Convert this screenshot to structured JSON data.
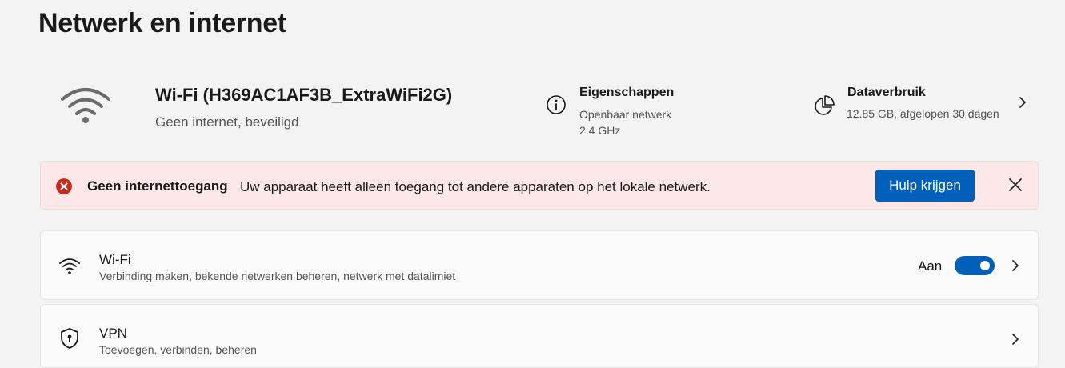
{
  "page": {
    "title": "Netwerk en internet"
  },
  "connection": {
    "name": "Wi-Fi (H369AC1AF3B_ExtraWiFi2G)",
    "status": "Geen internet, beveiligd",
    "icon": "wifi-icon"
  },
  "properties": {
    "title": "Eigenschappen",
    "network_type": "Openbaar netwerk",
    "band": "2.4 GHz",
    "icon": "info-icon"
  },
  "data_usage": {
    "title": "Dataverbruik",
    "summary": "12.85 GB, afgelopen 30 dagen",
    "icon": "pie-chart-icon"
  },
  "alert": {
    "title": "Geen internettoegang",
    "message": "Uw apparaat heeft alleen toegang tot andere apparaten op het lokale netwerk.",
    "button": "Hulp krijgen",
    "color": "#fde7e9",
    "icon_color": "#c42b1c"
  },
  "settings": [
    {
      "title": "Wi-Fi",
      "subtitle": "Verbinding maken, bekende netwerken beheren, netwerk met datalimiet",
      "toggle_label": "Aan",
      "toggle_on": true,
      "icon": "wifi-icon"
    },
    {
      "title": "VPN",
      "subtitle": "Toevoegen, verbinden, beheren",
      "icon": "shield-icon"
    }
  ],
  "accent_color": "#005fb8"
}
